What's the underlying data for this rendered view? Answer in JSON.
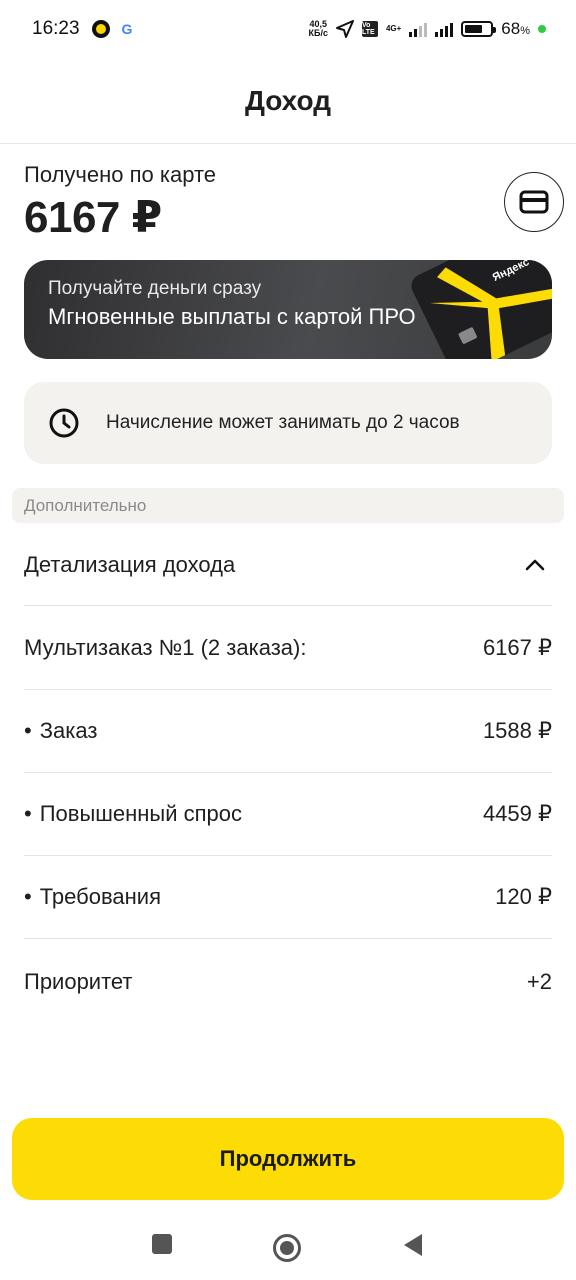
{
  "status_bar": {
    "time": "16:23",
    "net_speed_value": "40,5",
    "net_speed_unit": "КБ/с",
    "volte": "Vo LTE",
    "network": "4G+",
    "battery_percent": "68",
    "battery_unit": "%",
    "icons": [
      "yandex-pro-app-icon",
      "google-icon",
      "location-arrow-icon",
      "signal-bars-icon",
      "battery-icon"
    ]
  },
  "header": {
    "title": "Доход"
  },
  "received": {
    "label": "Получено по карте",
    "amount": "6167 ₽"
  },
  "promo": {
    "subtitle": "Получайте деньги сразу",
    "title": "Мгновенные выплаты с картой ПРО",
    "card_brand": "Яндекс"
  },
  "info": {
    "text": "Начисление может занимать до 2 часов"
  },
  "section": {
    "title": "Дополнительно"
  },
  "details": {
    "toggle_label": "Детализация дохода",
    "rows": [
      {
        "label": "Мультизаказ №1 (2 заказа):",
        "value": "6167 ₽",
        "bullet": false
      },
      {
        "label": "Заказ",
        "value": "1588 ₽",
        "bullet": true
      },
      {
        "label": "Повышенный спрос",
        "value": "4459 ₽",
        "bullet": true
      },
      {
        "label": "Требования",
        "value": "120 ₽",
        "bullet": true
      },
      {
        "label": "Приоритет",
        "value": "+2",
        "bullet": false
      }
    ],
    "bullet_char": "•"
  },
  "actions": {
    "continue_label": "Продолжить"
  },
  "colors": {
    "accent": "#fcdc04",
    "info_bg": "#f4f2ef",
    "promo_bg": "#3a3b3d"
  }
}
